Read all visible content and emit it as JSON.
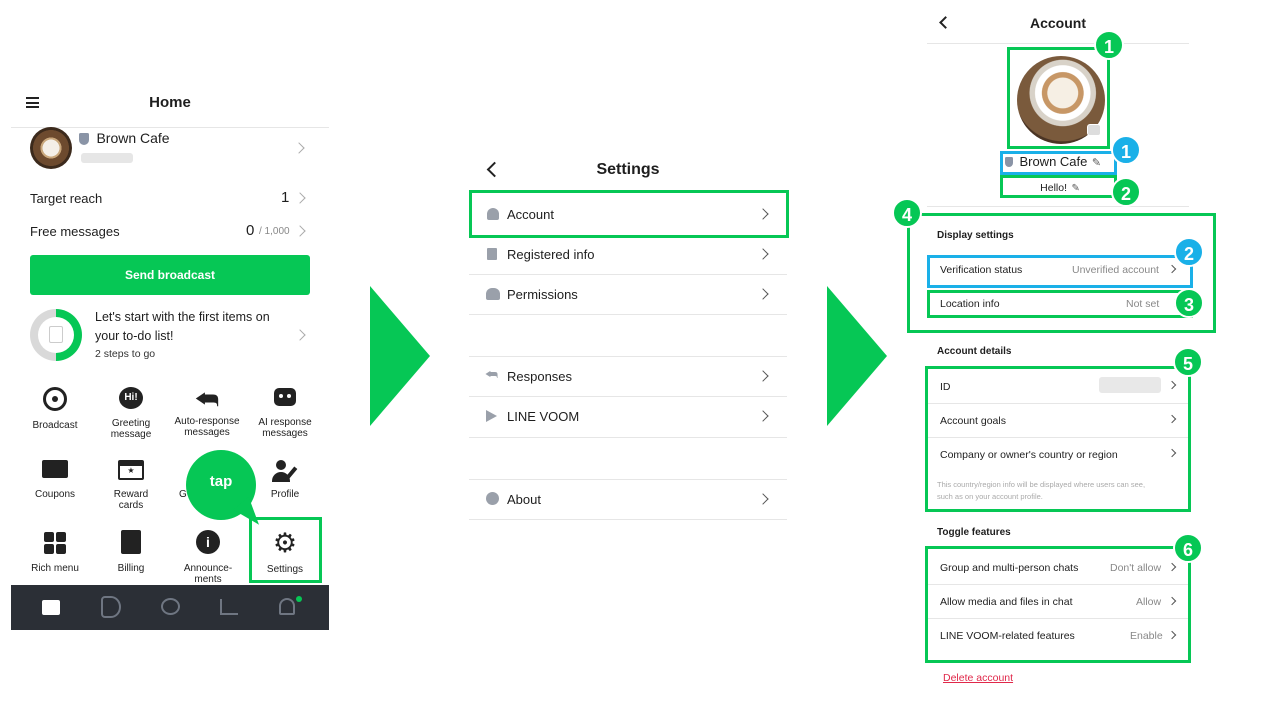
{
  "home": {
    "title": "Home",
    "account_name": "Brown Cafe",
    "target_reach_label": "Target reach",
    "target_reach_value": "1",
    "free_messages_label": "Free messages",
    "free_messages_value": "0",
    "free_messages_limit": "/ 1,000",
    "send_broadcast": "Send broadcast",
    "todo_line1": "Let's start with the first items on",
    "todo_line2": "your to-do list!",
    "todo_steps": "2 steps to go",
    "todo_progress": 0.5,
    "grid": [
      {
        "label1": "Broadcast",
        "label2": ""
      },
      {
        "label1": "Greeting",
        "label2": "message"
      },
      {
        "label1": "Auto-response",
        "label2": "messages"
      },
      {
        "label1": "AI response",
        "label2": "messages"
      },
      {
        "label1": "Coupons",
        "label2": ""
      },
      {
        "label1": "Reward",
        "label2": "cards"
      },
      {
        "label1": "G",
        "label2": ""
      },
      {
        "label1": "Profile",
        "label2": ""
      },
      {
        "label1": "Rich menu",
        "label2": ""
      },
      {
        "label1": "Billing",
        "label2": ""
      },
      {
        "label1": "Announce-",
        "label2": "ments"
      },
      {
        "label1": "Settings",
        "label2": ""
      }
    ],
    "tap_label": "tap"
  },
  "settings": {
    "title": "Settings",
    "items": [
      "Account",
      "Registered info",
      "Permissions",
      "Responses",
      "LINE VOOM",
      "About"
    ]
  },
  "account": {
    "title": "Account",
    "name": "Brown Cafe",
    "status_message": "Hello!",
    "display_settings_header": "Display settings",
    "verification_label": "Verification status",
    "verification_value": "Unverified account",
    "location_label": "Location info",
    "location_value": "Not set",
    "account_details_header": "Account details",
    "id_label": "ID",
    "goals_label": "Account goals",
    "country_label": "Company or owner's country or region",
    "country_note1": "This country/region info will be displayed where users can see,",
    "country_note2": "such as on your account profile.",
    "toggle_header": "Toggle features",
    "group_label": "Group and multi-person chats",
    "group_value": "Don't allow",
    "media_label": "Allow media and files in chat",
    "media_value": "Allow",
    "voom_label": "LINE VOOM-related features",
    "voom_value": "Enable",
    "delete_label": "Delete account"
  },
  "badges": {
    "b1": "1",
    "b1b": "1",
    "b2": "2",
    "b2b": "2",
    "b3": "3",
    "b4": "4",
    "b5": "5",
    "b6": "6"
  },
  "colors": {
    "accent": "#06c755",
    "annotation_blue": "#1ab0e8",
    "nav_bar": "#2b2f36",
    "delete_red": "#e0284a"
  }
}
